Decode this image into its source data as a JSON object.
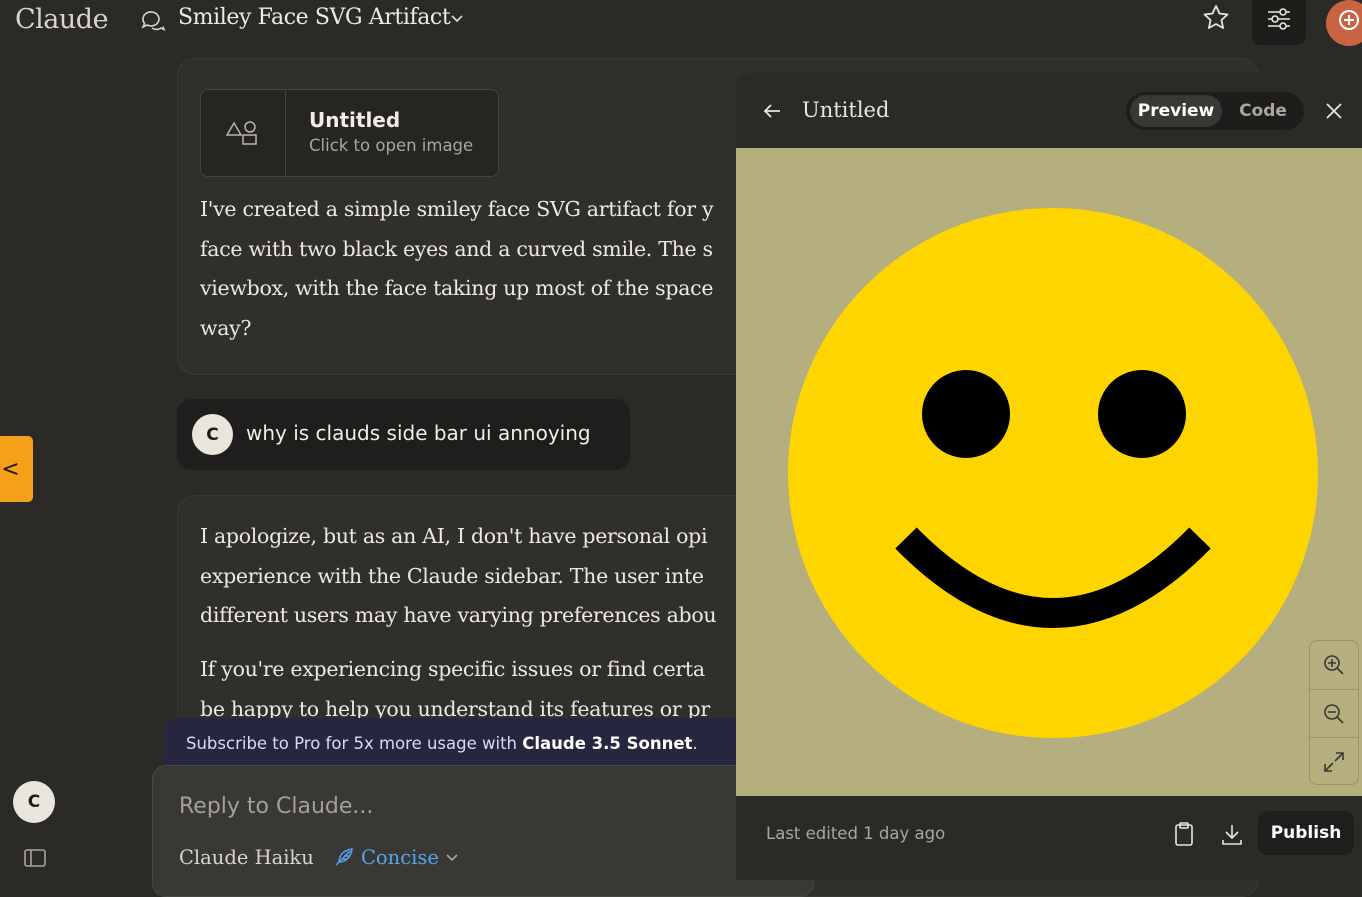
{
  "header": {
    "logo": "Claude",
    "conversation_title": "Smiley Face SVG Artifact"
  },
  "sidebar": {
    "toggle_label": "<",
    "user_initial": "C"
  },
  "messages": {
    "assistant_1": {
      "artifact": {
        "title": "Untitled",
        "subtitle": "Click to open image"
      },
      "lines": [
        "I've created a simple smiley face SVG artifact for y",
        "face with two black eyes and a curved smile. The s",
        "viewbox, with the face taking up most of the space",
        "way?"
      ]
    },
    "user_1": {
      "initial": "C",
      "text": "why is clauds side bar ui annoying"
    },
    "assistant_2": {
      "p1_lines": [
        "I apologize, but as an AI, I don't have personal opi",
        "experience with the Claude sidebar. The user inte",
        "different users may have varying preferences abou"
      ],
      "p2_lines": [
        "If you're experiencing specific issues or find certa",
        "be happy to help you understand its features or pr"
      ]
    }
  },
  "subscribe": {
    "prefix": "Subscribe to Pro for 5x more usage with ",
    "highlight": "Claude 3.5 Sonnet",
    "suffix": "."
  },
  "composer": {
    "placeholder": "Reply to Claude...",
    "model": "Claude Haiku",
    "style": "Concise"
  },
  "artifact_panel": {
    "title": "Untitled",
    "tabs": {
      "preview": "Preview",
      "code": "Code"
    },
    "active_tab": "Preview",
    "last_edited": "Last edited 1 day ago",
    "publish_label": "Publish",
    "canvas_background": "#b5ae7e",
    "smiley": {
      "face_color": "#ffd500",
      "feature_color": "#000000"
    }
  },
  "colors": {
    "accent_orange": "#c96442",
    "sidebar_tab": "#f4a018",
    "link_blue": "#5aa2ee"
  }
}
